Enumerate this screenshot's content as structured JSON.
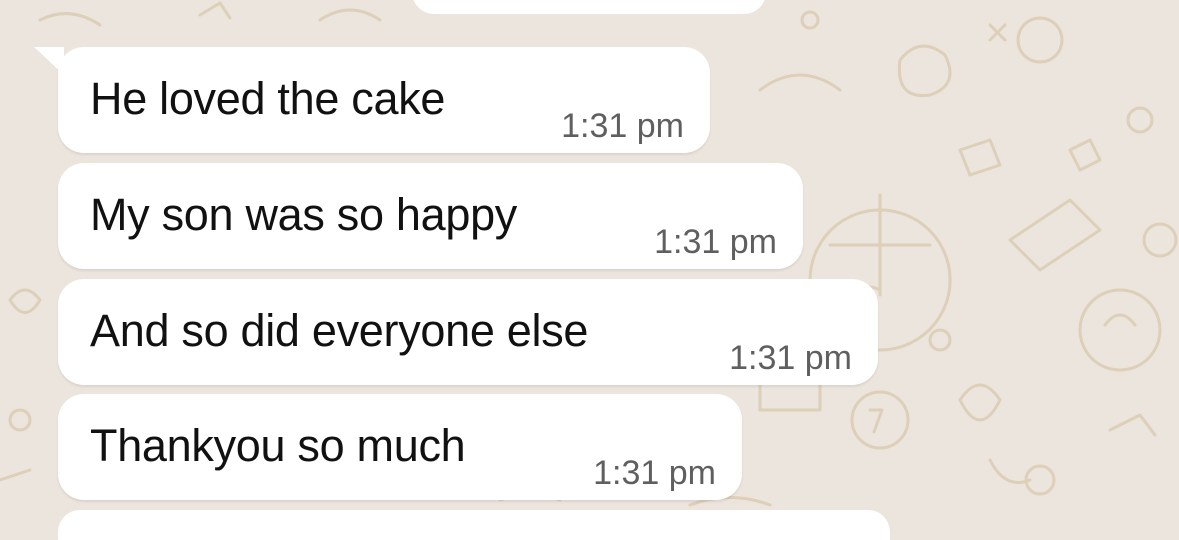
{
  "chat": {
    "messages": [
      {
        "text": "He loved the cake",
        "time": "1:31 pm"
      },
      {
        "text": "My son was so happy",
        "time": "1:31 pm"
      },
      {
        "text": "And so did everyone else",
        "time": "1:31 pm"
      },
      {
        "text": "Thankyou so much",
        "time": "1:31 pm"
      }
    ]
  },
  "colors": {
    "background": "#ECE5DD",
    "bubble": "#FFFFFF",
    "doodle": "#DCCDB4"
  }
}
